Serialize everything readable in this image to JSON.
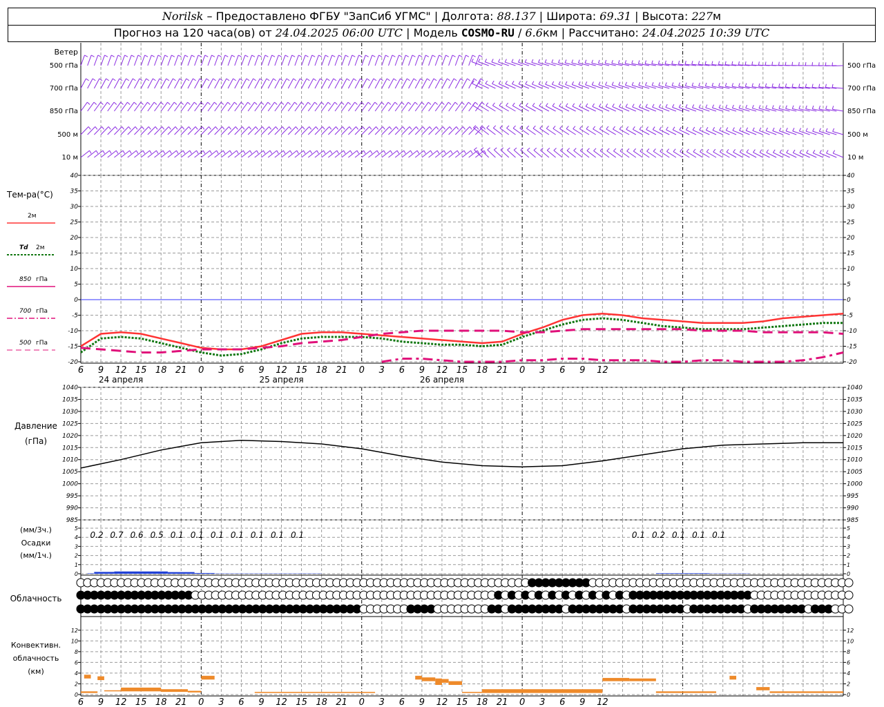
{
  "header": {
    "station": "Norilsk",
    "source": "– Предоставлено ФГБУ \"ЗапСиб УГМС\"",
    "lon_label": "Долгота:",
    "lon": "88.137",
    "lat_label": "Широта:",
    "lat": "69.31",
    "alt_label": "Высота:",
    "alt": "227",
    "alt_unit": "м",
    "forecast_label": "Прогноз на 120 часа(ов) от",
    "forecast_start": "24.04.2025 06:00 UTC",
    "model_label": "Модель",
    "model": "COSMO-RU",
    "resolution": "6.6",
    "res_unit": "км",
    "computed_label": "Рассчитано:",
    "computed": "24.04.2025 10:39 UTC"
  },
  "colors": {
    "t2m": "#ff3333",
    "td2m": "#117711",
    "t850": "#e0107a",
    "t700": "#e0107a",
    "t500": "#e0107a",
    "wind": "#8a2be2",
    "precip": "#1f3fd6",
    "conv": "#ee8a2a",
    "zero_line": "#3333ff",
    "grid": "#999999"
  },
  "panels": {
    "wind": {
      "title": "Ветер",
      "levels": [
        "500 гПа",
        "700 гПа",
        "850 гПа",
        "500 м",
        "10 м"
      ]
    },
    "temperature": {
      "title": "Тем-ра(°C)",
      "legend": [
        {
          "label": "2м",
          "prefix": "",
          "style": "solid"
        },
        {
          "label": "2м",
          "prefix": "Td",
          "style": "dotted"
        },
        {
          "label": "гПа",
          "prefix": "850",
          "style": "solid"
        },
        {
          "label": "гПа",
          "prefix": "700",
          "style": "dashdot"
        },
        {
          "label": "гПа",
          "prefix": "500",
          "style": "dashed"
        }
      ],
      "ticks": [
        "40",
        "35",
        "30",
        "25",
        "20",
        "15",
        "10",
        "5",
        "0",
        "-5",
        "-10",
        "-15",
        "-20"
      ]
    },
    "pressure": {
      "title_1": "Давление",
      "title_2": "(гПа)",
      "ticks": [
        "1040",
        "1035",
        "1030",
        "1025",
        "1020",
        "1015",
        "1010",
        "1005",
        "1000",
        "995",
        "990",
        "985"
      ]
    },
    "precipitation": {
      "title_1": "(мм/3ч.)",
      "title_2": "Осадки",
      "title_3": "(мм/1ч.)",
      "ticks": [
        "5",
        "4",
        "3",
        "2",
        "1",
        "0"
      ]
    },
    "clouds": {
      "title": "Облачность"
    },
    "convective": {
      "title_1": "Конвективн.",
      "title_2": "облачность",
      "title_3": "(км)",
      "ticks": [
        "12",
        "10",
        "8",
        "6",
        "4",
        "2",
        "0"
      ]
    }
  },
  "x_axis": {
    "hour_labels": [
      "6",
      "9",
      "12",
      "15",
      "18",
      "21",
      "0",
      "3",
      "6",
      "9",
      "12",
      "15",
      "18",
      "21",
      "0",
      "3",
      "6",
      "9",
      "12",
      "15",
      "18",
      "21",
      "0",
      "3",
      "6",
      "9",
      "12"
    ],
    "day_labels": [
      "24 апреля",
      "25 апреля",
      "26 апреля"
    ]
  },
  "chart_data": [
    {
      "type": "line",
      "title": "Тем-ра(°C)",
      "x_hours": [
        0,
        3,
        6,
        9,
        12,
        15,
        18,
        21,
        24,
        27,
        30,
        33,
        36,
        39,
        42,
        45,
        48,
        51,
        54,
        57,
        60,
        63,
        66,
        69,
        72,
        75,
        78,
        81,
        84,
        87,
        90,
        93,
        96,
        99,
        102,
        105,
        108,
        111,
        114
      ],
      "ylim": [
        -20,
        40
      ],
      "series": [
        {
          "name": "2м",
          "values": [
            -15,
            -11,
            -10.5,
            -11,
            -12.5,
            -14,
            -15.5,
            -16,
            -16,
            -15,
            -13,
            -11,
            -10.5,
            -10.5,
            -11,
            -11.5,
            -12,
            -12.5,
            -13,
            -13.5,
            -14,
            -13.5,
            -11,
            -9,
            -6.5,
            -5,
            -4.5,
            -5,
            -6,
            -6.5,
            -7,
            -7.5,
            -7.5,
            -7.5,
            -7,
            -6,
            -5.5,
            -5,
            -4.5
          ]
        },
        {
          "name": "Td 2м",
          "values": [
            -17,
            -12.5,
            -12,
            -12.5,
            -14,
            -15.5,
            -17,
            -18,
            -17.5,
            -16,
            -14,
            -12.5,
            -12,
            -12,
            -12,
            -12.5,
            -13.5,
            -14,
            -14.5,
            -14.5,
            -15,
            -14.5,
            -12,
            -10,
            -8,
            -6.5,
            -6,
            -6.5,
            -7.5,
            -8.5,
            -9,
            -9.5,
            -9.5,
            -9.5,
            -9,
            -8.5,
            -8,
            -7.5,
            -7.5
          ]
        },
        {
          "name": "850 гПа",
          "values": [
            -15.5,
            -16,
            -16.5,
            -17,
            -17,
            -16.5,
            -16,
            -16,
            -16,
            -15.5,
            -15,
            -14,
            -13.5,
            -13,
            -12,
            -11,
            -10.5,
            -10,
            -10,
            -10,
            -10,
            -10,
            -10.5,
            -10.5,
            -10,
            -9.5,
            -9.5,
            -9.5,
            -9.5,
            -9.5,
            -9.5,
            -10,
            -10,
            -10,
            -10.5,
            -10.5,
            -10.5,
            -10.5,
            -11
          ]
        },
        {
          "name": "700 гПа",
          "values": [
            null,
            null,
            null,
            null,
            null,
            null,
            null,
            null,
            null,
            null,
            null,
            null,
            null,
            null,
            null,
            -20,
            -19,
            -19,
            -19.5,
            -20,
            -20,
            -20,
            -19.5,
            -19.5,
            -19,
            -19,
            -19.5,
            -19.5,
            -19.5,
            -20,
            -20,
            -19.5,
            -19.5,
            -20,
            -20,
            -20,
            -19.5,
            -18.5,
            -17
          ]
        },
        {
          "name": "500 гПа",
          "values": [
            null,
            null,
            null,
            null,
            null,
            null,
            null,
            null,
            null,
            null,
            null,
            null,
            null,
            null,
            null,
            null,
            null,
            null,
            null,
            null,
            null,
            null,
            null,
            null,
            null,
            null,
            null,
            null,
            null,
            null,
            null,
            null,
            null,
            null,
            null,
            null,
            null,
            null,
            null
          ]
        }
      ]
    },
    {
      "type": "line",
      "title": "Давление (гПа)",
      "x_hours": [
        0,
        6,
        12,
        18,
        24,
        30,
        36,
        42,
        48,
        54,
        60,
        66,
        72,
        78,
        84,
        90,
        96,
        102,
        108,
        114
      ],
      "ylim": [
        985,
        1040
      ],
      "series": [
        {
          "name": "Давление",
          "values": [
            1006.5,
            1010,
            1014,
            1017,
            1018,
            1017.5,
            1016.5,
            1014.5,
            1011.5,
            1009,
            1007.5,
            1007,
            1007.5,
            1009.5,
            1012,
            1014.5,
            1016,
            1016.5,
            1017,
            1017
          ]
        }
      ]
    },
    {
      "type": "bar",
      "title": "Осадки",
      "ylim": [
        0,
        5
      ],
      "labels_3h": [
        {
          "hour": 3,
          "value": "0.2"
        },
        {
          "hour": 6,
          "value": "0.7"
        },
        {
          "hour": 9,
          "value": "0.6"
        },
        {
          "hour": 12,
          "value": "0.5"
        },
        {
          "hour": 15,
          "value": "0.1"
        },
        {
          "hour": 18,
          "value": "0.1"
        },
        {
          "hour": 21,
          "value": "0.1"
        },
        {
          "hour": 24,
          "value": "0.1"
        },
        {
          "hour": 27,
          "value": "0.1"
        },
        {
          "hour": 30,
          "value": "0.1"
        },
        {
          "hour": 33,
          "value": "0.1"
        },
        {
          "hour": 84,
          "value": "0.1"
        },
        {
          "hour": 87,
          "value": "0.2"
        },
        {
          "hour": 90,
          "value": "0.1"
        },
        {
          "hour": 93,
          "value": "0.1"
        },
        {
          "hour": 96,
          "value": "0.1"
        }
      ],
      "hourly": [
        {
          "from": 1,
          "to": 2,
          "value": 0.05
        },
        {
          "from": 2,
          "to": 5,
          "value": 0.2
        },
        {
          "from": 5,
          "to": 13,
          "value": 0.25
        },
        {
          "from": 13,
          "to": 17,
          "value": 0.18
        },
        {
          "from": 17,
          "to": 20,
          "value": 0.08
        },
        {
          "from": 20,
          "to": 36,
          "value": 0.03
        },
        {
          "from": 86,
          "to": 94,
          "value": 0.06
        },
        {
          "from": 94,
          "to": 100,
          "value": 0.03
        }
      ]
    },
    {
      "type": "bar",
      "title": "Конвективная облачность (км)",
      "ylim": [
        0,
        13
      ],
      "segments": [
        {
          "from": 0.5,
          "to": 1.5,
          "bottom": 3,
          "top": 3.7
        },
        {
          "from": 0,
          "to": 2.5,
          "bottom": 0.3,
          "top": 0.6
        },
        {
          "from": 2.5,
          "to": 3.5,
          "bottom": 2.7,
          "top": 3.4
        },
        {
          "from": 3.5,
          "to": 6,
          "bottom": 0.6,
          "top": 0.8
        },
        {
          "from": 6,
          "to": 12,
          "bottom": 0.6,
          "top": 1.3
        },
        {
          "from": 12,
          "to": 16,
          "bottom": 0.5,
          "top": 1
        },
        {
          "from": 16,
          "to": 18,
          "bottom": 0.4,
          "top": 0.7
        },
        {
          "from": 18,
          "to": 20,
          "bottom": 2.8,
          "top": 3.5
        },
        {
          "from": 26,
          "to": 44,
          "bottom": 0.3,
          "top": 0.5
        },
        {
          "from": 50,
          "to": 51,
          "bottom": 2.8,
          "top": 3.5
        },
        {
          "from": 51,
          "to": 53,
          "bottom": 2.5,
          "top": 3.2
        },
        {
          "from": 53,
          "to": 54,
          "bottom": 1.8,
          "top": 3
        },
        {
          "from": 54,
          "to": 55,
          "bottom": 2.2,
          "top": 2.9
        },
        {
          "from": 55,
          "to": 57,
          "bottom": 1.8,
          "top": 2.5
        },
        {
          "from": 57,
          "to": 60,
          "bottom": 0.3,
          "top": 0.5
        },
        {
          "from": 60,
          "to": 78,
          "bottom": 0.3,
          "top": 1
        },
        {
          "from": 78,
          "to": 82,
          "bottom": 2.5,
          "top": 3.1
        },
        {
          "from": 82,
          "to": 86,
          "bottom": 2.5,
          "top": 3
        },
        {
          "from": 86,
          "to": 95,
          "bottom": 0.3,
          "top": 0.6
        },
        {
          "from": 97,
          "to": 98,
          "bottom": 2.8,
          "top": 3.5
        },
        {
          "from": 101,
          "to": 103,
          "bottom": 0.8,
          "top": 1.4
        },
        {
          "from": 103,
          "to": 114,
          "bottom": 0.3,
          "top": 0.6
        }
      ]
    }
  ]
}
